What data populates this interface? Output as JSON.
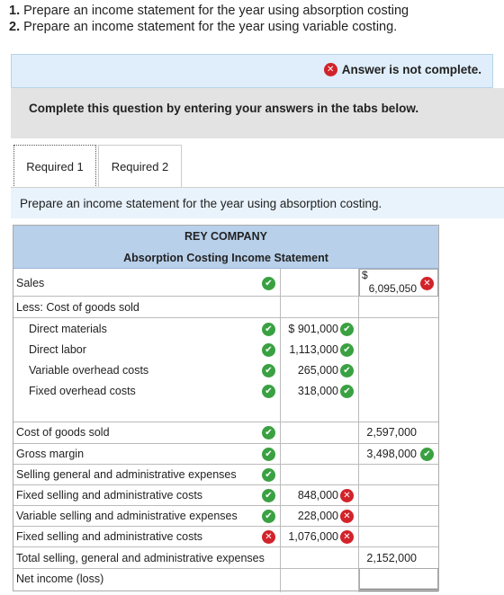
{
  "instructions": [
    {
      "num": "1.",
      "text": " Prepare an income statement for the year using absorption costing"
    },
    {
      "num": "2.",
      "text": " Prepare an income statement for the year using variable costing."
    }
  ],
  "banner": {
    "message": "Answer is not complete."
  },
  "complete_text": "Complete this question by entering your answers in the tabs below.",
  "tabs": [
    {
      "label": "Required 1"
    },
    {
      "label": "Required 2"
    }
  ],
  "prompt": "Prepare an income statement for the year using absorption costing.",
  "statement": {
    "company": "REY COMPANY",
    "title": "Absorption Costing Income Statement",
    "sales_label": "Sales",
    "sales_currency": "$",
    "sales_value": "6,095,050",
    "less_cogs_label": "Less: Cost of goods sold",
    "cogs_items": [
      {
        "label": "Direct materials",
        "value": "$ 901,000"
      },
      {
        "label": "Direct labor",
        "value": "1,113,000"
      },
      {
        "label": "Variable overhead costs",
        "value": "265,000"
      },
      {
        "label": "Fixed overhead costs",
        "value": "318,000"
      }
    ],
    "cogs_label": "Cost of goods sold",
    "cogs_value": "2,597,000",
    "gross_margin_label": "Gross margin",
    "gross_margin_value": "3,498,000",
    "sga_header": "Selling general and administrative expenses",
    "sga_items": [
      {
        "label": "Fixed selling and administrative costs",
        "value": "848,000"
      },
      {
        "label": "Variable selling and administrative expenses",
        "value": "228,000"
      },
      {
        "label": "Fixed selling and administrative costs",
        "value": "1,076,000"
      }
    ],
    "total_sga_label": "Total selling, general and administrative expenses",
    "total_sga_value": "2,152,000",
    "net_income_label": "Net income (loss)",
    "net_income_value": ""
  },
  "icons": {
    "check": "✔",
    "cross": "✕",
    "correct_color": "#3aa142",
    "wrong_color": "#d2232a"
  }
}
